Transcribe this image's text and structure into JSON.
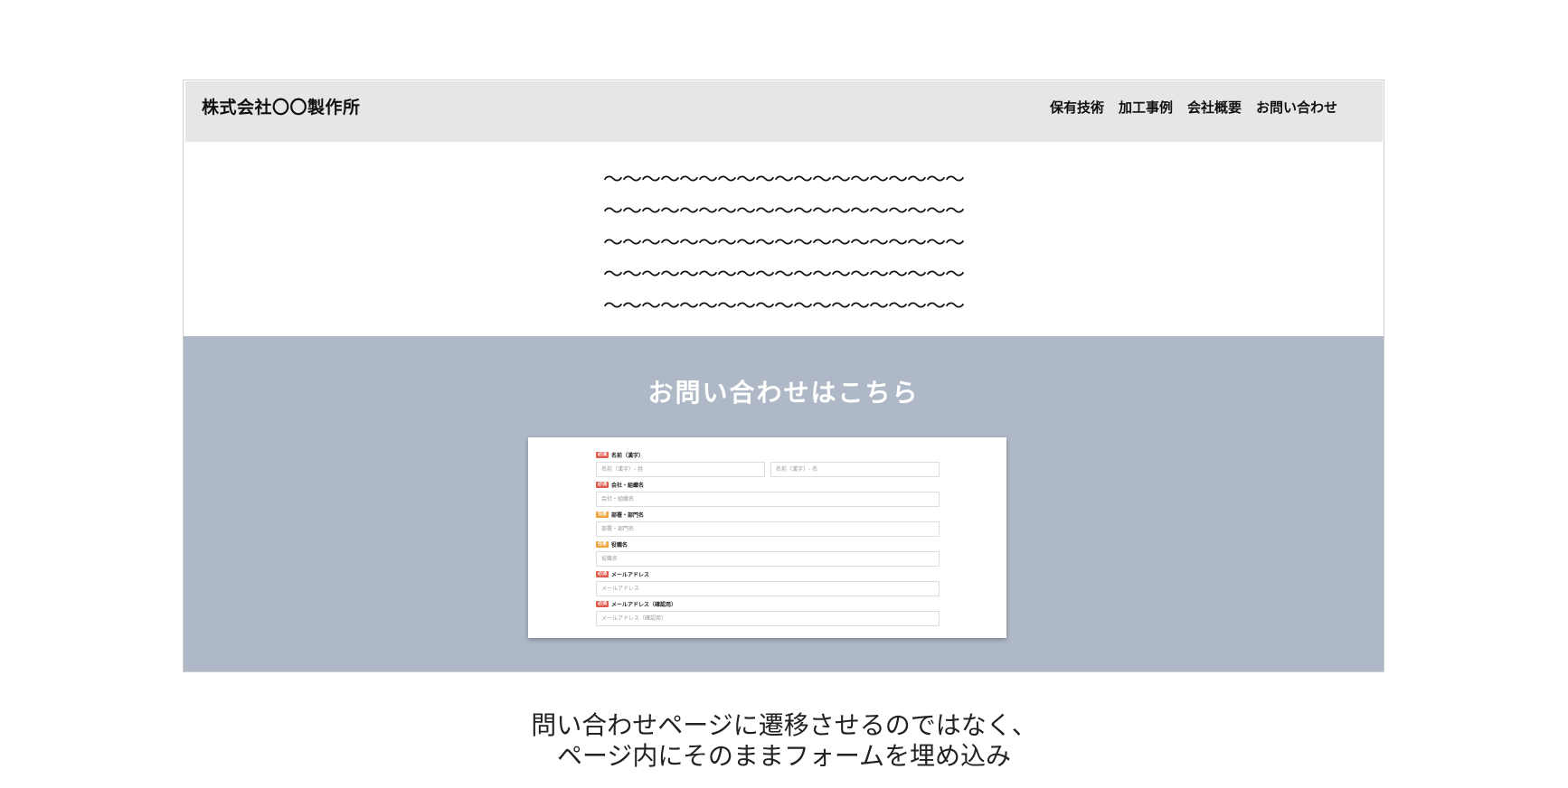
{
  "header": {
    "logo": "株式会社〇〇製作所",
    "nav": [
      "保有技術",
      "加工事例",
      "会社概要",
      "お問い合わせ"
    ]
  },
  "hero": {
    "lines": [
      "〜〜〜〜〜〜〜〜〜〜〜〜〜〜〜〜〜〜〜",
      "〜〜〜〜〜〜〜〜〜〜〜〜〜〜〜〜〜〜〜",
      "〜〜〜〜〜〜〜〜〜〜〜〜〜〜〜〜〜〜〜",
      "〜〜〜〜〜〜〜〜〜〜〜〜〜〜〜〜〜〜〜",
      "〜〜〜〜〜〜〜〜〜〜〜〜〜〜〜〜〜〜〜"
    ]
  },
  "contact": {
    "heading": "お問い合わせはこちら",
    "fields": [
      {
        "badge": "必須",
        "badge_type": "required",
        "label": "名前（漢字）",
        "placeholders": [
          "名前（漢字）- 姓",
          "名前（漢字）- 名"
        ]
      },
      {
        "badge": "必須",
        "badge_type": "required",
        "label": "会社・組織名",
        "placeholders": [
          "会社・組織名"
        ]
      },
      {
        "badge": "任意",
        "badge_type": "optional",
        "label": "部署・部門名",
        "placeholders": [
          "部署・部門名"
        ]
      },
      {
        "badge": "任意",
        "badge_type": "optional",
        "label": "役職名",
        "placeholders": [
          "役職名"
        ]
      },
      {
        "badge": "必須",
        "badge_type": "required",
        "label": "メールアドレス",
        "placeholders": [
          "メールアドレス"
        ]
      },
      {
        "badge": "必須",
        "badge_type": "required",
        "label": "メールアドレス（確認用）",
        "placeholders": [
          "メールアドレス（確認用）"
        ]
      }
    ]
  },
  "caption": {
    "line1": "問い合わせページに遷移させるのではなく、",
    "line2": "ページ内にそのままフォームを埋め込み"
  },
  "colors": {
    "header_bg": "#e6e6e6",
    "section_bg": "#afb8c7",
    "required_badge": "#e05a4e",
    "optional_badge": "#f0a53a"
  }
}
